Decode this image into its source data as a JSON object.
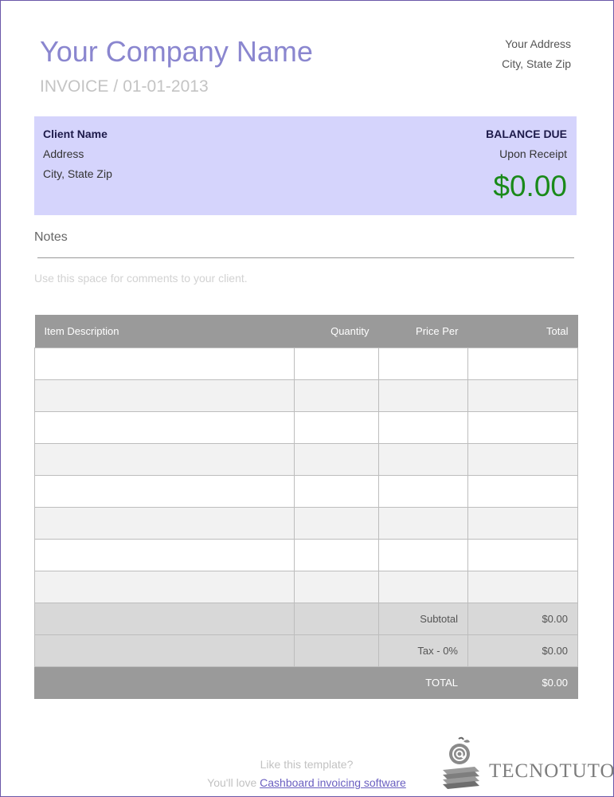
{
  "company": {
    "name": "Your Company Name",
    "invoice_label": "INVOICE",
    "date": "01-01-2013",
    "address_line1": "Your Address",
    "address_line2": "City, State Zip"
  },
  "client": {
    "name": "Client Name",
    "address": "Address",
    "city": "City, State Zip",
    "balance_label": "BALANCE DUE",
    "terms": "Upon Receipt",
    "amount": "$0.00"
  },
  "notes": {
    "title": "Notes",
    "placeholder": "Use this space for comments to your client."
  },
  "table": {
    "headers": [
      "Item Description",
      "Quantity",
      "Price Per",
      "Total"
    ],
    "rows": [
      [
        "",
        "",
        "",
        ""
      ],
      [
        "",
        "",
        "",
        ""
      ],
      [
        "",
        "",
        "",
        ""
      ],
      [
        "",
        "",
        "",
        ""
      ],
      [
        "",
        "",
        "",
        ""
      ],
      [
        "",
        "",
        "",
        ""
      ],
      [
        "",
        "",
        "",
        ""
      ],
      [
        "",
        "",
        "",
        ""
      ]
    ],
    "subtotal_label": "Subtotal",
    "subtotal_value": "$0.00",
    "tax_label": "Tax - 0%",
    "tax_value": "$0.00",
    "total_label": "TOTAL",
    "total_value": "$0.00"
  },
  "footer": {
    "line1": "Like this template?",
    "line2_prefix": "You'll love ",
    "link_text": "Cashboard invoicing software"
  },
  "watermark": {
    "brand": "TECNOTUTO",
    "logo_icon": "apple-books-at-icon"
  },
  "colors": {
    "company_name": "#8a86cf",
    "client_box": "#d5d4fc",
    "amount": "#1a8a1a",
    "table_header": "#9a9a9a"
  }
}
